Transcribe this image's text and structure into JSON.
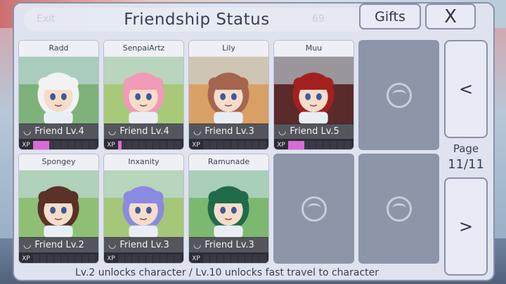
{
  "header": {
    "title": "Friendship Status",
    "gifts_label": "Gifts",
    "close_label": "X",
    "ghost_exit": "Exit",
    "ghost_count": "69"
  },
  "cards": [
    {
      "name": "Radd",
      "level": "Friend Lv.4",
      "xp_fraction": 0.25,
      "hair": "#f2f2f4",
      "bg": "#7fb27a"
    },
    {
      "name": "SenpaiArtz",
      "level": "Friend Lv.4",
      "xp_fraction": 0.05,
      "hair": "#f29ab6",
      "bg": "#a8c97a"
    },
    {
      "name": "Lily",
      "level": "Friend Lv.3",
      "xp_fraction": 0.0,
      "hair": "#a5654f",
      "bg": "#d9a066"
    },
    {
      "name": "Muu",
      "level": "Friend Lv.5",
      "xp_fraction": 0.25,
      "hair": "#a3201f",
      "bg": "#5b2a2a"
    },
    {
      "name": "Spongey",
      "level": "Friend Lv.2",
      "xp_fraction": 0.0,
      "hair": "#5a3228",
      "bg": "#8fbf74"
    },
    {
      "name": "Inxanity",
      "level": "Friend Lv.3",
      "xp_fraction": 0.0,
      "hair": "#8a8ae0",
      "bg": "#a4c77a"
    },
    {
      "name": "Ramunade",
      "level": "Friend Lv.3",
      "xp_fraction": 0.0,
      "hair": "#1f6b4a",
      "bg": "#7db871"
    }
  ],
  "xp_label": "XP",
  "pagination": {
    "label": "Page",
    "value": "11/11",
    "prev": "<",
    "next": ">"
  },
  "footer": "Lv.2 unlocks character / Lv.10 unlocks fast travel to character"
}
